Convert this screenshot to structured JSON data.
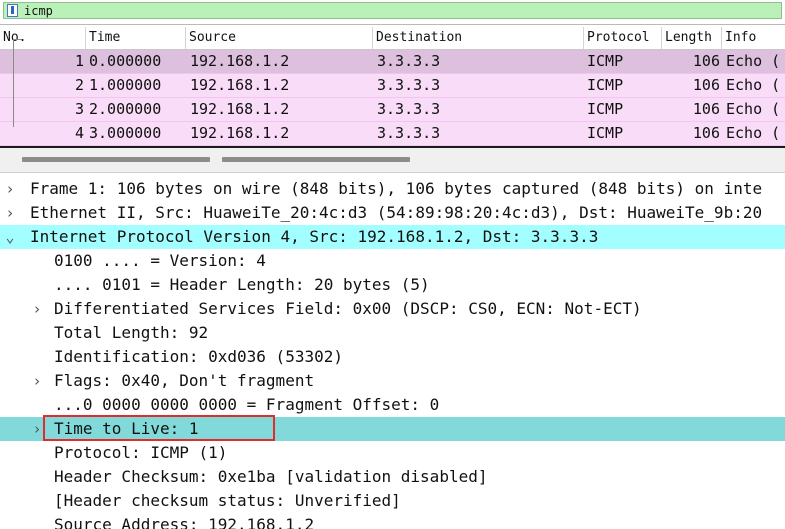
{
  "filter": {
    "value": "icmp",
    "icon": "bookmark-icon"
  },
  "packet_list": {
    "columns": [
      "No.",
      "Time",
      "Source",
      "Destination",
      "Protocol",
      "Length",
      "Info"
    ],
    "rows": [
      {
        "no": "1",
        "time": "0.000000",
        "source": "192.168.1.2",
        "destination": "3.3.3.3",
        "protocol": "ICMP",
        "length": "106",
        "info": "Echo ("
      },
      {
        "no": "2",
        "time": "1.000000",
        "source": "192.168.1.2",
        "destination": "3.3.3.3",
        "protocol": "ICMP",
        "length": "106",
        "info": "Echo ("
      },
      {
        "no": "3",
        "time": "2.000000",
        "source": "192.168.1.2",
        "destination": "3.3.3.3",
        "protocol": "ICMP",
        "length": "106",
        "info": "Echo ("
      },
      {
        "no": "4",
        "time": "3.000000",
        "source": "192.168.1.2",
        "destination": "3.3.3.3",
        "protocol": "ICMP",
        "length": "106",
        "info": "Echo ("
      }
    ]
  },
  "details": [
    {
      "text": "Frame 1: 106 bytes on wire (848 bits), 106 bytes captured (848 bits) on inte",
      "expander": "›"
    },
    {
      "text": "Ethernet II, Src: HuaweiTe_20:4c:d3 (54:89:98:20:4c:d3), Dst: HuaweiTe_9b:20",
      "expander": "›"
    },
    {
      "text": "Internet Protocol Version 4, Src: 192.168.1.2, Dst: 3.3.3.3",
      "expander": "⌄"
    },
    {
      "text": "0100 .... = Version: 4",
      "expander": ""
    },
    {
      "text": ".... 0101 = Header Length: 20 bytes (5)",
      "expander": ""
    },
    {
      "text": "Differentiated Services Field: 0x00 (DSCP: CS0, ECN: Not-ECT)",
      "expander": "›"
    },
    {
      "text": "Total Length: 92",
      "expander": ""
    },
    {
      "text": "Identification: 0xd036 (53302)",
      "expander": ""
    },
    {
      "text": "Flags: 0x40, Don't fragment",
      "expander": "›"
    },
    {
      "text": "...0 0000 0000 0000 = Fragment Offset: 0",
      "expander": ""
    },
    {
      "text": "Time to Live: 1",
      "expander": "›"
    },
    {
      "text": "Protocol: ICMP (1)",
      "expander": ""
    },
    {
      "text": "Header Checksum: 0xe1ba [validation disabled]",
      "expander": ""
    },
    {
      "text": "[Header checksum status: Unverified]",
      "expander": ""
    },
    {
      "text": "Source Address: 192.168.1.2",
      "expander": ""
    }
  ],
  "colors": {
    "filter_valid": "#b9f1b8",
    "row_icmp": "#f9dcf7",
    "row_selected": "#dcc0de",
    "ipv4_highlight": "#a3ffff",
    "selected_field": "#82d9d9",
    "annotation_box": "#e32b2b"
  }
}
